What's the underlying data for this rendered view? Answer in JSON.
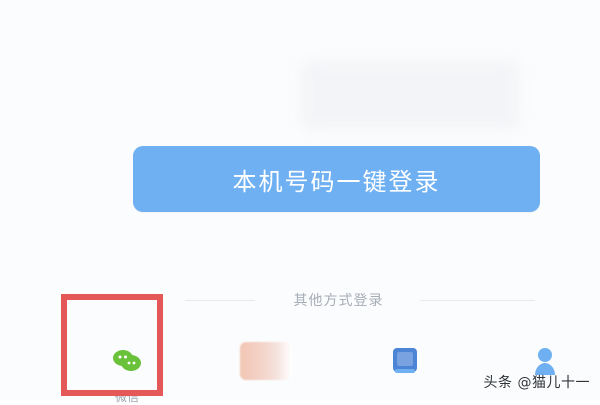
{
  "login": {
    "onekey_button_label": "本机号码一键登录",
    "other_methods_label": "其他方式登录"
  },
  "options": [
    {
      "id": "wechat",
      "icon": "wechat-icon",
      "label": "微信"
    },
    {
      "id": "qq",
      "icon": "qq-icon",
      "label": ""
    },
    {
      "id": "phone",
      "icon": "phone-icon",
      "label": ""
    },
    {
      "id": "account",
      "icon": "user-icon",
      "label": ""
    }
  ],
  "watermark": {
    "text": "头条 @猫儿十一"
  },
  "colors": {
    "primary_button": "#6fb0f2",
    "wechat_green": "#6ac13a",
    "highlight_red": "#e45858",
    "text_muted": "#a7adb6"
  }
}
